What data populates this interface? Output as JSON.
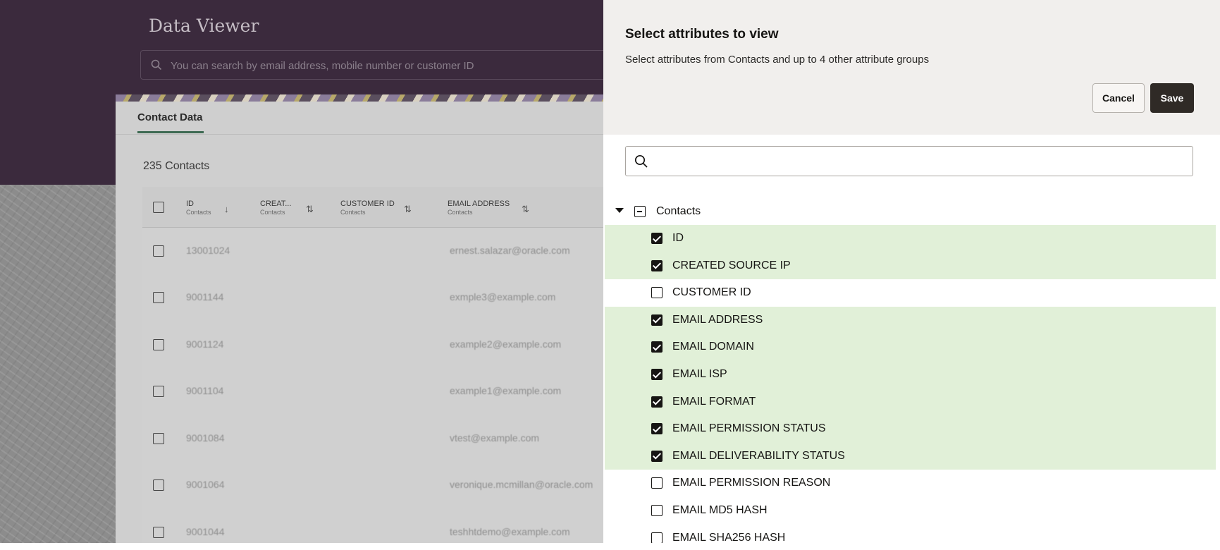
{
  "app": {
    "title": "Data Viewer"
  },
  "search": {
    "placeholder": "You can search by email address, mobile number or customer ID"
  },
  "tabs": [
    {
      "label": "Contact Data"
    }
  ],
  "contacts_count": "235 Contacts",
  "grid": {
    "columns": [
      {
        "title": "ID",
        "group": "Contacts",
        "sort": "descending"
      },
      {
        "title": "CREAT...",
        "group": "Contacts",
        "sort": "sortable"
      },
      {
        "title": "CUSTOMER ID",
        "group": "Contacts",
        "sort": "sortable"
      },
      {
        "title": "EMAIL ADDRESS",
        "group": "Contacts",
        "sort": "sortable"
      }
    ],
    "rows": [
      {
        "id": "13001024",
        "email": "ernest.salazar@oracle.com"
      },
      {
        "id": "9001144",
        "email": "exmple3@example.com"
      },
      {
        "id": "9001124",
        "email": "example2@example.com"
      },
      {
        "id": "9001104",
        "email": "example1@example.com"
      },
      {
        "id": "9001084",
        "email": "vtest@example.com"
      },
      {
        "id": "9001064",
        "email": "veronique.mcmillan@oracle.com"
      },
      {
        "id": "9001044",
        "email": "teshhtdemo@example.com"
      }
    ]
  },
  "drawer": {
    "title": "Select attributes to view",
    "subtitle": "Select attributes from Contacts and up to 4 other attribute groups",
    "cancel_label": "Cancel",
    "save_label": "Save",
    "search_value": "",
    "group": {
      "label": "Contacts",
      "expanded": true,
      "state": "partial"
    },
    "attributes": [
      {
        "label": "ID",
        "checked": true
      },
      {
        "label": "CREATED SOURCE IP",
        "checked": true
      },
      {
        "label": "CUSTOMER ID",
        "checked": false
      },
      {
        "label": "EMAIL ADDRESS",
        "checked": true
      },
      {
        "label": "EMAIL DOMAIN",
        "checked": true
      },
      {
        "label": "EMAIL ISP",
        "checked": true
      },
      {
        "label": "EMAIL FORMAT",
        "checked": true
      },
      {
        "label": "EMAIL PERMISSION STATUS",
        "checked": true
      },
      {
        "label": "EMAIL DELIVERABILITY STATUS",
        "checked": true
      },
      {
        "label": "EMAIL PERMISSION REASON",
        "checked": false
      },
      {
        "label": "EMAIL MD5 HASH",
        "checked": false
      },
      {
        "label": "EMAIL SHA256 HASH",
        "checked": false
      }
    ]
  },
  "colors": {
    "header_bg": "#3b2a3d",
    "drawer_head_bg": "#f1efed",
    "selected_row_bg": "#e1f0d8",
    "save_button_bg": "#2f2a26",
    "tab_underline": "#3d6a52"
  }
}
